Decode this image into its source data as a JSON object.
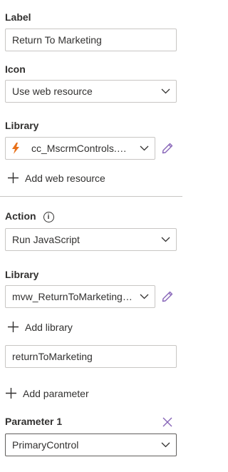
{
  "label_section": {
    "title": "Label",
    "value": "Return To Marketing"
  },
  "icon_section": {
    "title": "Icon",
    "selected": "Use web resource"
  },
  "library_section_1": {
    "title": "Library",
    "selected": "cc_MscrmControls.Ge...",
    "add_label": "Add web resource"
  },
  "action_section": {
    "title": "Action",
    "info_glyph": "i",
    "selected": "Run JavaScript"
  },
  "library_section_2": {
    "title": "Library",
    "selected": "mvw_ReturnToMarketingC...",
    "add_label": "Add library"
  },
  "function_field": {
    "value": "returnToMarketing"
  },
  "add_parameter": {
    "label": "Add parameter"
  },
  "parameter_1": {
    "title": "Parameter 1",
    "selected": "PrimaryControl"
  },
  "colors": {
    "accent": "#8764b8",
    "lightning": "#e8711a",
    "border": "#c8c6c4",
    "text": "#323130"
  }
}
